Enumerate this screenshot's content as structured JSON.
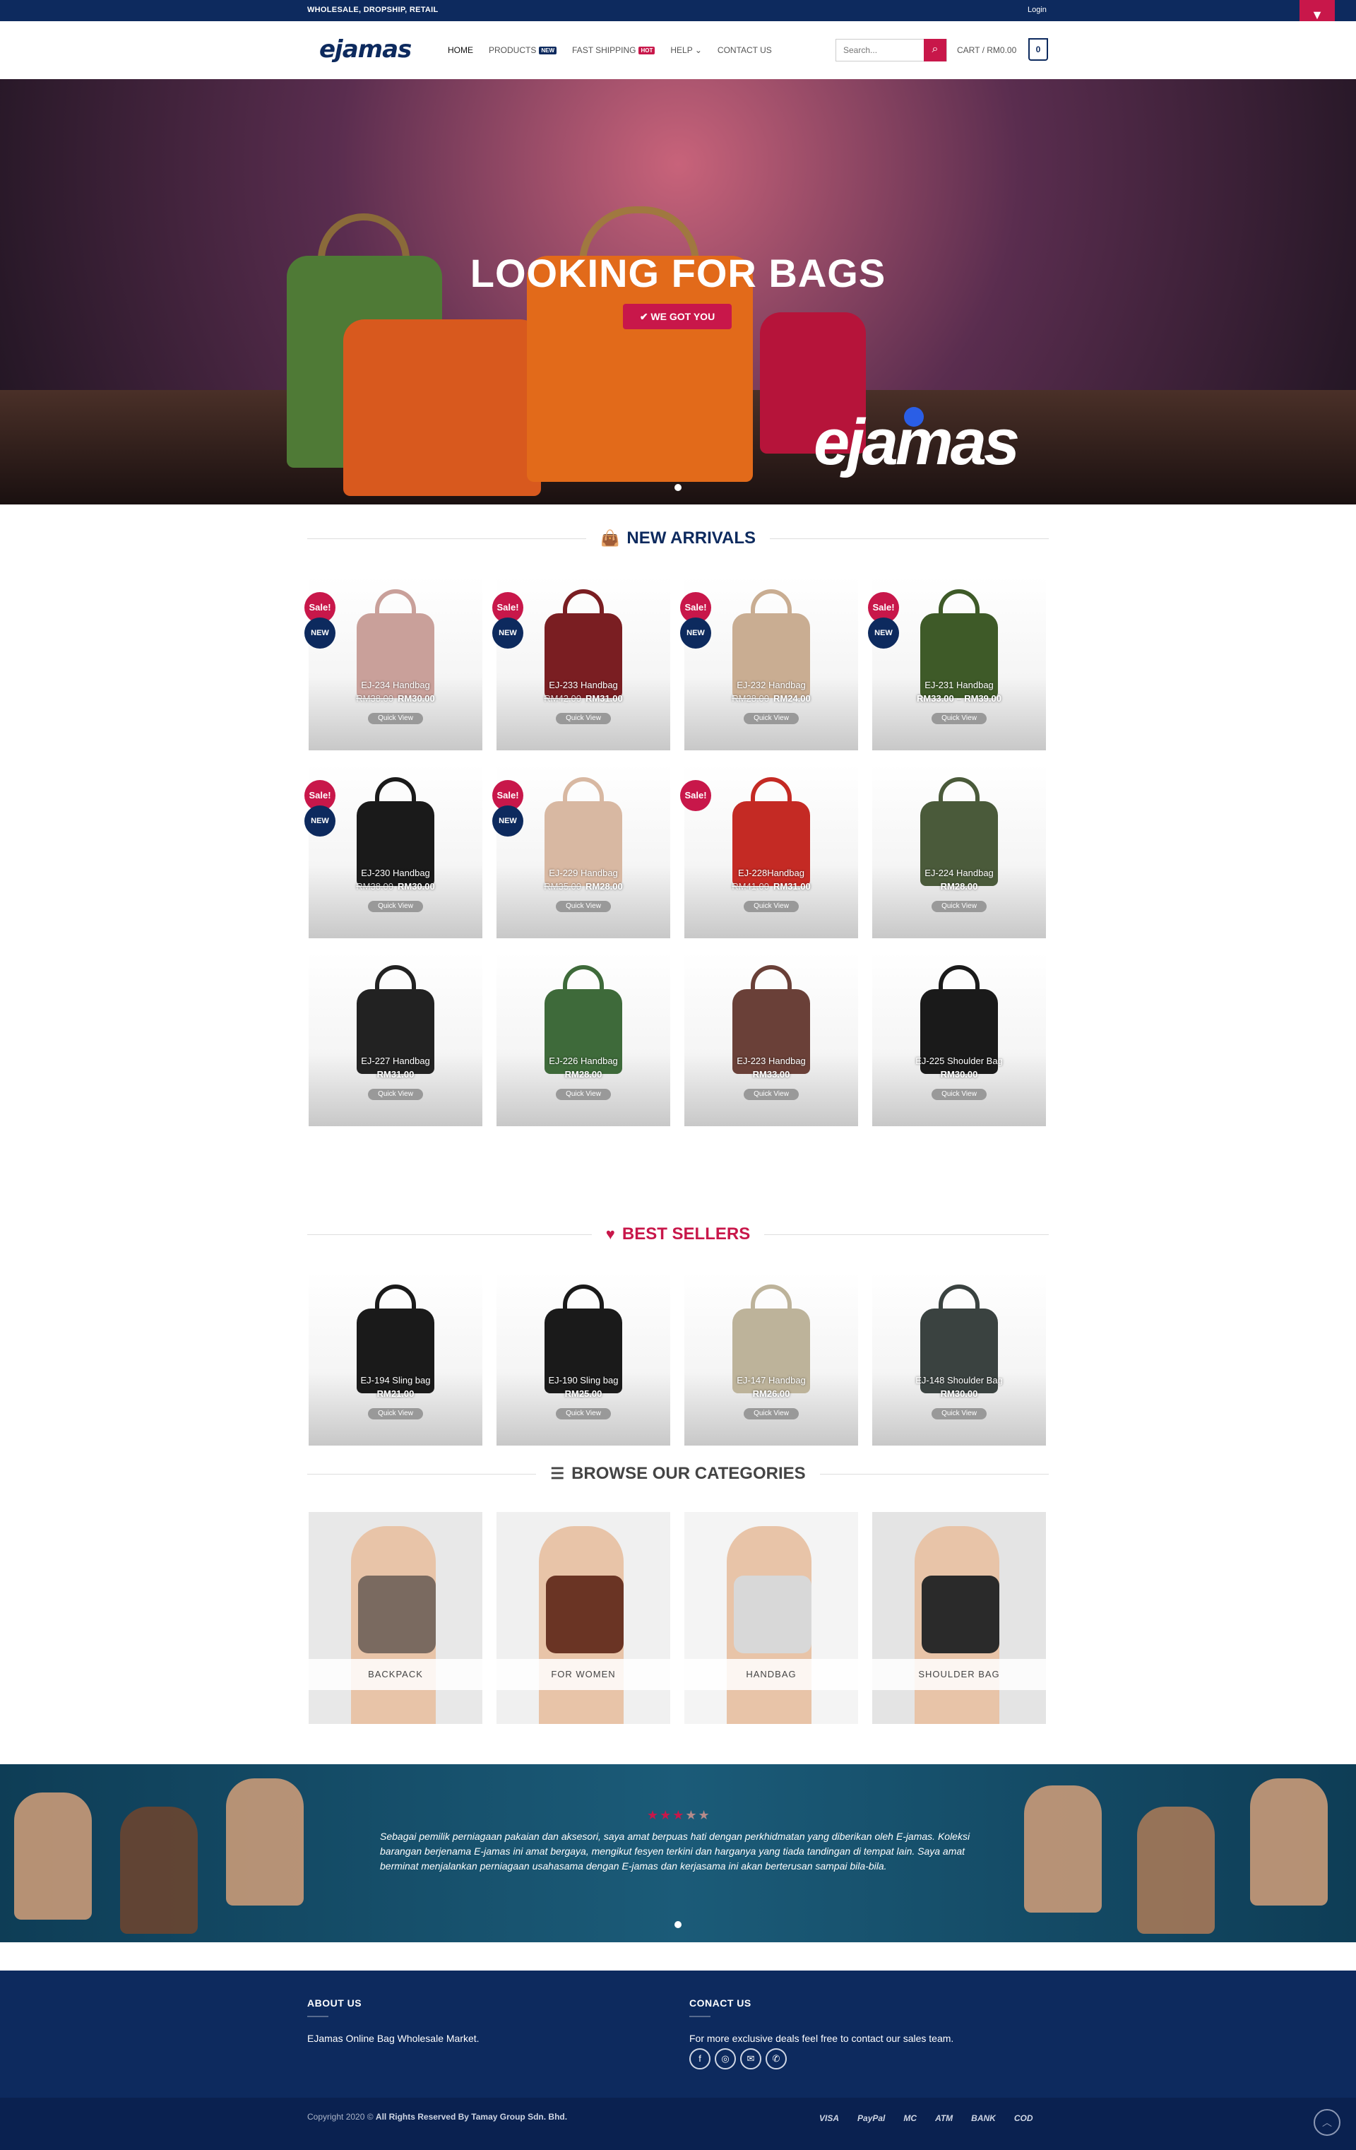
{
  "topbar": {
    "tagline": "WHOLESALE, DROPSHIP, RETAIL",
    "login": "Login",
    "dropdown_icon": "▼"
  },
  "header": {
    "logo": "ejamas",
    "nav": [
      {
        "label": "HOME",
        "badge": ""
      },
      {
        "label": "PRODUCTS",
        "badge": "NEW"
      },
      {
        "label": "FAST SHIPPING",
        "badge": "HOT"
      },
      {
        "label": "HELP ⌄",
        "badge": ""
      },
      {
        "label": "CONTACT US",
        "badge": ""
      }
    ],
    "search_placeholder": "Search...",
    "cart_label": "CART / RM0.00",
    "cart_count": "0"
  },
  "hero": {
    "headline": "LOOKING FOR BAGS",
    "cta": "✔  WE GOT YOU",
    "brand": "ejamas"
  },
  "new_arrivals": {
    "title": "NEW ARRIVALS",
    "products": [
      {
        "name": "EJ-234 Handbag",
        "old": "RM38.00",
        "price": "RM30.00",
        "sale": true,
        "new": true,
        "color": "#c9a09a"
      },
      {
        "name": "EJ-233 Handbag",
        "old": "RM42.00",
        "price": "RM31.00",
        "sale": true,
        "new": true,
        "color": "#7a1e22"
      },
      {
        "name": "EJ-232 Handbag",
        "old": "RM28.00",
        "price": "RM24.00",
        "sale": true,
        "new": true,
        "color": "#c9ad92"
      },
      {
        "name": "EJ-231 Handbag",
        "old": "",
        "price": "RM33.00 – RM39.00",
        "sale": true,
        "new": true,
        "color": "#3e5a28"
      },
      {
        "name": "EJ-230 Handbag",
        "old": "RM38.00",
        "price": "RM30.00",
        "sale": true,
        "new": true,
        "color": "#1a1a1a"
      },
      {
        "name": "EJ-229 Handbag",
        "old": "RM35.00",
        "price": "RM28.00",
        "sale": true,
        "new": true,
        "color": "#d8b8a2"
      },
      {
        "name": "EJ-228Handbag",
        "old": "RM41.00",
        "price": "RM31.00",
        "sale": true,
        "new": false,
        "color": "#c42a24"
      },
      {
        "name": "EJ-224 Handbag",
        "old": "",
        "price": "RM28.00",
        "sale": false,
        "new": false,
        "color": "#4a5a3a"
      },
      {
        "name": "EJ-227 Handbag",
        "old": "",
        "price": "RM31.00",
        "sale": false,
        "new": false,
        "color": "#222222"
      },
      {
        "name": "EJ-226 Handbag",
        "old": "",
        "price": "RM28.00",
        "sale": false,
        "new": false,
        "color": "#3e6a3a"
      },
      {
        "name": "EJ-223 Handbag",
        "old": "",
        "price": "RM33.00",
        "sale": false,
        "new": false,
        "color": "#6a4038"
      },
      {
        "name": "EJ-225 Shoulder Bag",
        "old": "",
        "price": "RM30.00",
        "sale": false,
        "new": false,
        "color": "#1a1a1a"
      }
    ],
    "quick_view": "Quick View",
    "sale_label": "Sale!",
    "new_label": "NEW"
  },
  "best_sellers": {
    "title": "BEST SELLERS",
    "products": [
      {
        "name": "EJ-194 Sling bag",
        "price": "RM21.00",
        "color": "#1a1a1a"
      },
      {
        "name": "EJ-190 Sling bag",
        "price": "RM25.00",
        "color": "#1a1a1a"
      },
      {
        "name": "EJ-147 Handbag",
        "price": "RM26.00",
        "color": "#bdb39a"
      },
      {
        "name": "EJ-148 Shoulder Bag",
        "price": "RM30.00",
        "color": "#3a4240"
      }
    ]
  },
  "categories": {
    "title": "BROWSE OUR CATEGORIES",
    "items": [
      {
        "label": "BACKPACK",
        "bg": "#e8e8e8",
        "color": "#7a6a60"
      },
      {
        "label": "FOR WOMEN",
        "bg": "#f0f0f0",
        "color": "#6a3424"
      },
      {
        "label": "HANDBAG",
        "bg": "#f4f4f4",
        "color": "#d8d8d8"
      },
      {
        "label": "SHOULDER BAG",
        "bg": "#e4e4e4",
        "color": "#2a2a2a"
      }
    ]
  },
  "testimonial": {
    "stars": "★★★",
    "stars_dim": "★★",
    "quote": "Sebagai pemilik perniagaan pakaian dan aksesori, saya amat berpuas hati dengan perkhidmatan yang diberikan oleh E-jamas. Koleksi barangan berjenama E-jamas ini amat bergaya, mengikut fesyen terkini dan harganya yang tiada tandingan di tempat lain. Saya amat berminat menjalankan perniagaan usahasama dengan E-jamas dan kerjasama ini akan berterusan sampai bila-bila."
  },
  "footer": {
    "about_title": "ABOUT US",
    "about_text": "EJamas Online Bag Wholesale Market.",
    "contact_title": "CONACT US",
    "contact_text": "For more exclusive deals feel free to contact our sales team.",
    "social": [
      "f",
      "◎",
      "✉",
      "✆"
    ],
    "copyright_prefix": "Copyright 2020 © ",
    "copyright_bold": "All Rights Reserved By Tamay Group Sdn. Bhd.",
    "payments": [
      "VISA",
      "PayPal",
      "MC",
      "ATM",
      "BANK",
      "COD"
    ],
    "totop": "︿"
  },
  "colors": {
    "navy": "#0d2a5e",
    "accent": "#c8174a"
  }
}
